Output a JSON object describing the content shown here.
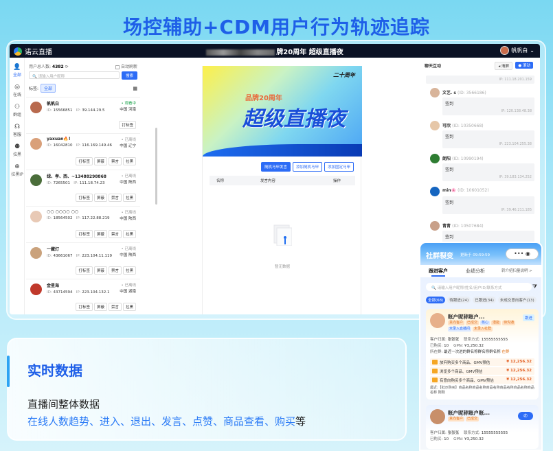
{
  "banner": {
    "title": "场控辅助+CDM用户行为轨迹追踪"
  },
  "topbar": {
    "logo": "诺云直播",
    "live_title": "牌20周年 超级直播夜",
    "user_name": "帆帆白"
  },
  "nav": [
    {
      "icon": "user-icon",
      "glyph": "👤",
      "label": "全部"
    },
    {
      "icon": "online-icon",
      "glyph": "◎",
      "label": "在线"
    },
    {
      "icon": "team-icon",
      "glyph": "⚇",
      "label": "群组"
    },
    {
      "icon": "headset-icon",
      "glyph": "☊",
      "label": "客服"
    },
    {
      "icon": "add-user-icon",
      "glyph": "⚉",
      "label": "拉黑"
    },
    {
      "icon": "globe-icon",
      "glyph": "⊕",
      "label": "拉黑IP"
    }
  ],
  "left_panel": {
    "online_label": "用户总人数:",
    "online_count": "4382",
    "auto_refresh": "自动刷新",
    "search_placeholder": "请输入用户昵称",
    "search_button": "搜索",
    "tag_label": "标签:",
    "tag_all": "全部",
    "users": [
      {
        "name": "帆帆白",
        "status": "• 观看中",
        "online": true,
        "id": "15566851",
        "ip": "39.144.29.5",
        "region": "中国 河南",
        "avatar_color": "#b86a4e",
        "actions": [
          "打标签"
        ]
      },
      {
        "name": "yaxuan🔥!",
        "status": "• 已离线",
        "online": false,
        "id": "16042810",
        "ip": "116.169.149.46",
        "region": "中国 辽宁",
        "avatar_color": "#d9a07a",
        "actions": [
          "打标签",
          "屏蔽",
          "禁言",
          "拉黑"
        ]
      },
      {
        "name": "绿、孝、西、~13488298868",
        "status": "• 已离线",
        "online": false,
        "id": "7265501",
        "ip": "111.18.74.23",
        "region": "中国 陕西",
        "avatar_color": "#4a6d3a",
        "actions": [
          "打标签",
          "屏蔽",
          "禁言",
          "拉黑"
        ]
      },
      {
        "name": "○○ ○○○○ ○○",
        "status": "• 已离线",
        "online": false,
        "id": "18564502",
        "ip": "117.22.88.219",
        "region": "中国 陕西",
        "avatar_color": "#e8c9b5",
        "actions": [
          "打标签",
          "屏蔽",
          "禁言",
          "拉黑"
        ]
      },
      {
        "name": "一藏灯",
        "status": "• 已离线",
        "online": false,
        "id": "43661067",
        "ip": "223.104.11.119",
        "region": "中国 陕西",
        "avatar_color": "#caa27c",
        "actions": [
          "打标签",
          "屏蔽",
          "禁言",
          "拉黑"
        ]
      },
      {
        "name": "金星海",
        "status": "• 已离线",
        "online": false,
        "id": "43714594",
        "ip": "223.104.132.1",
        "region": "中国 湖南",
        "avatar_color": "#c0392b",
        "actions": [
          "打标签",
          "屏蔽",
          "禁言",
          "拉黑"
        ]
      }
    ],
    "id_label": "ID:",
    "ip_label": "IP:"
  },
  "center": {
    "poster": {
      "small": "品牌20周年",
      "big": "超级直播夜",
      "corner": "二十周年"
    },
    "buttons": [
      "随机马甲发言",
      "添加随机马甲",
      "添加固定马甲"
    ],
    "table_headers": [
      "名称",
      "发言内容",
      "操作"
    ],
    "empty_text": "暂无数据"
  },
  "chat": {
    "title": "聊天互动",
    "clear_button": "清屏",
    "scroll_button": "滚动",
    "top_ip": "IP: 111.18.201.159",
    "messages": [
      {
        "name": "文艺. s",
        "id": "(ID: 3566186)",
        "text": "签到",
        "ip": "IP: 120.138.48.38",
        "avatar_color": "#d8b49a"
      },
      {
        "name": "可欣",
        "id": "(ID: 10350668)",
        "text": "签到",
        "ip": "IP: 223.104.255.38",
        "avatar_color": "#e6c7a8"
      },
      {
        "name": "朗阳",
        "id": "(ID: 10990194)",
        "text": "签到",
        "ip": "IP: 39.183.134.252",
        "avatar_color": "#2e7d32"
      },
      {
        "name": "min🌸",
        "id": "(ID: 10601052)",
        "text": "签到",
        "ip": "IP: 39.46.211.185",
        "avatar_color": "#1565c0"
      },
      {
        "name": "青青",
        "id": "(ID: 10507684)",
        "text": "签到",
        "ip": "",
        "avatar_color": "#c8a089"
      }
    ]
  },
  "feature": {
    "heading": "实时数据",
    "line1": "直播间整体数据",
    "line2_blue": "在线人数趋势、进入、退出、发言、点赞、商品查看、购买",
    "line2_tail": "等"
  },
  "phone": {
    "title": "社群裂变",
    "update": "更新于 09:59:59",
    "pill": "••• ◉",
    "tabs": [
      "跟进客户",
      "业绩分析",
      "转介绍扫量说明 >"
    ],
    "search_placeholder": "请输入用户昵称/姓名/用户ID/联系方式",
    "chips": [
      "全部(68)",
      "待跟进(24)",
      "已跟进(34)",
      "未成交意向客户(13)"
    ],
    "card1": {
      "name": "账户昵称账户...",
      "badge": "跟进",
      "tags": [
        "意向客户",
        "已成交",
        "核心",
        "潜能",
        "待沟通",
        "未录入直播间",
        "未录入社群"
      ],
      "buyer_label": "客户归属:",
      "buyer": "张张张",
      "contact_label": "联系方式:",
      "contact": "15555555555",
      "buy_label": "已购买:",
      "buy": "10",
      "gmv_label": "GMV:",
      "gmv": "¥3,250.32",
      "recent_label": "所在群:",
      "recent": "最近一次进的群名称群名称群名称",
      "recent_tag": "在群",
      "goods": [
        {
          "text": "放弃购买多个商品、GMV预估",
          "price": "¥ 12,256.32"
        },
        {
          "text": "浏览多个商品、GMV预估",
          "price": "¥ 12,256.32"
        },
        {
          "text": "有意向购买多个商品、GMV预估",
          "price": "¥ 12,256.32"
        }
      ],
      "note": "最近:【批示购买】商品名称商品名称商品名称商品名称商品名称商品名称 刚刚"
    },
    "card2": {
      "name": "账户昵称账户账...",
      "tags": [
        "意向客户",
        "已成交"
      ],
      "buyer_label": "客户归属:",
      "buyer": "张张张",
      "contact_label": "联系方式:",
      "contact": "15555555555",
      "buy_label": "已购买:",
      "buy": "10",
      "gmv_label": "GMV:",
      "gmv": "¥3,250.32"
    }
  }
}
